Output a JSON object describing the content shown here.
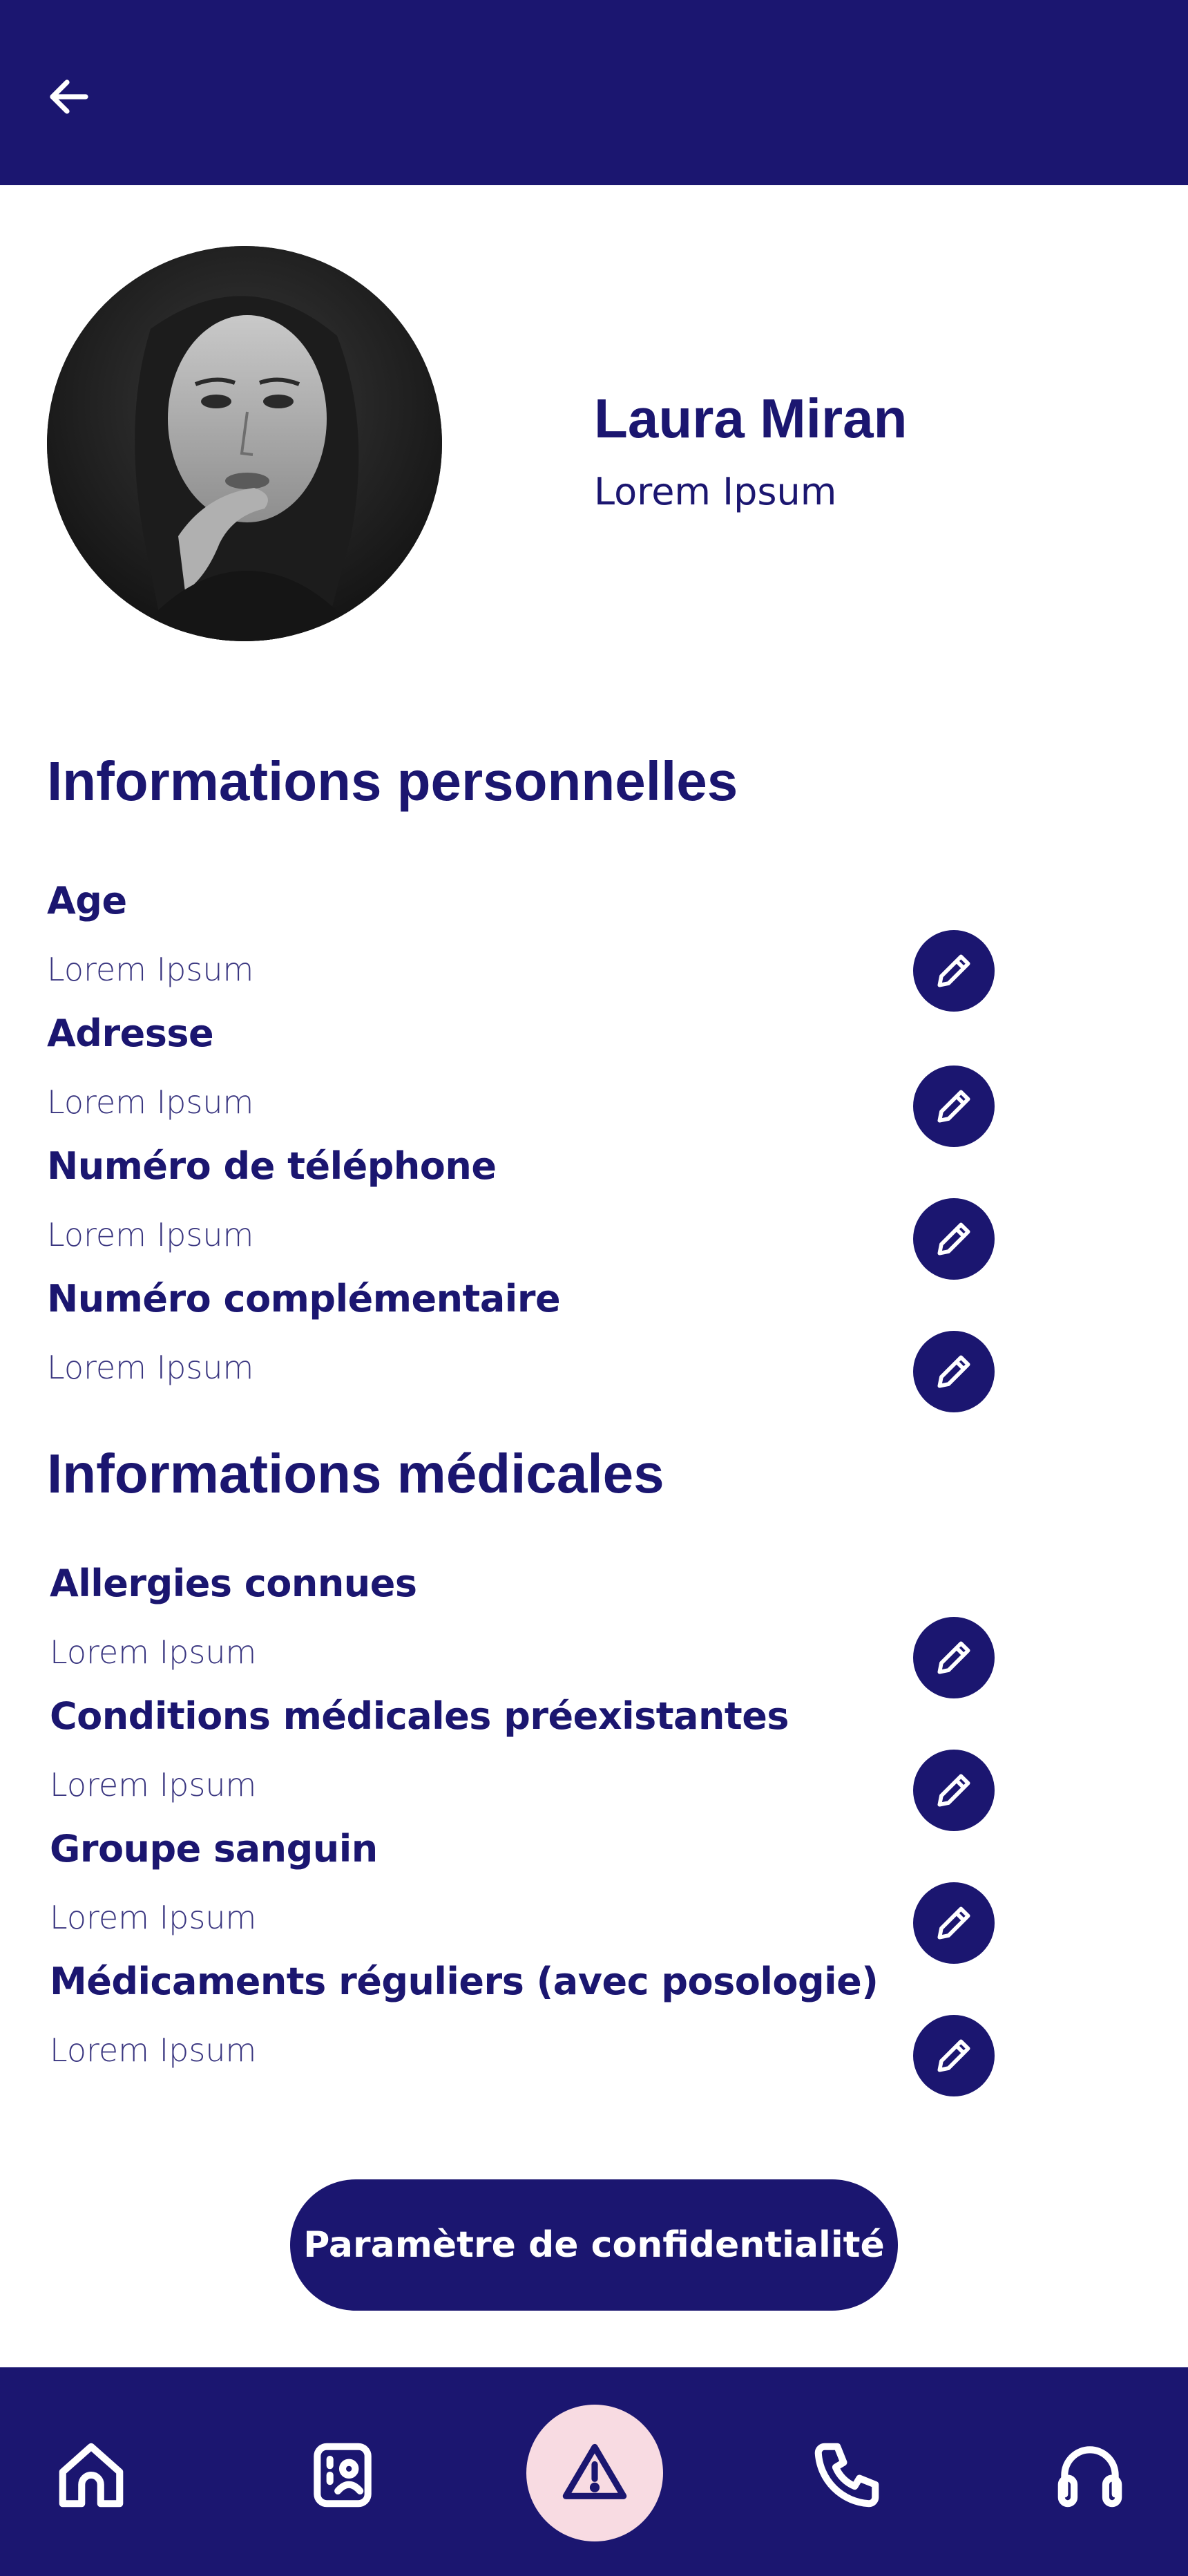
{
  "header": {
    "back_icon": "arrow-left-icon"
  },
  "profile": {
    "name": "Laura Miran",
    "subtitle": "Lorem Ipsum"
  },
  "personal": {
    "title": "Informations personnelles",
    "fields": [
      {
        "label": "Age",
        "value": "Lorem Ipsum"
      },
      {
        "label": "Adresse",
        "value": "Lorem Ipsum"
      },
      {
        "label": "Numéro de téléphone",
        "value": "Lorem Ipsum"
      },
      {
        "label": "Numéro complémentaire",
        "value": "Lorem Ipsum"
      }
    ]
  },
  "medical": {
    "title": "Informations médicales",
    "fields": [
      {
        "label": "Allergies connues",
        "value": "Lorem Ipsum"
      },
      {
        "label": "Conditions médicales préexistantes",
        "value": "Lorem Ipsum"
      },
      {
        "label": "Groupe sanguin",
        "value": "Lorem Ipsum"
      },
      {
        "label": "Médicaments réguliers (avec posologie)",
        "value": "Lorem Ipsum"
      }
    ]
  },
  "privacy_button": {
    "label": "Paramètre de confidentialité"
  },
  "bottom_nav": {
    "items": [
      "home-icon",
      "contacts-card-icon",
      "alert-triangle-icon",
      "phone-icon",
      "headset-icon"
    ]
  },
  "colors": {
    "primary": "#1b1670",
    "alert_bg": "#f8dbe2",
    "background": "#ffffff"
  }
}
